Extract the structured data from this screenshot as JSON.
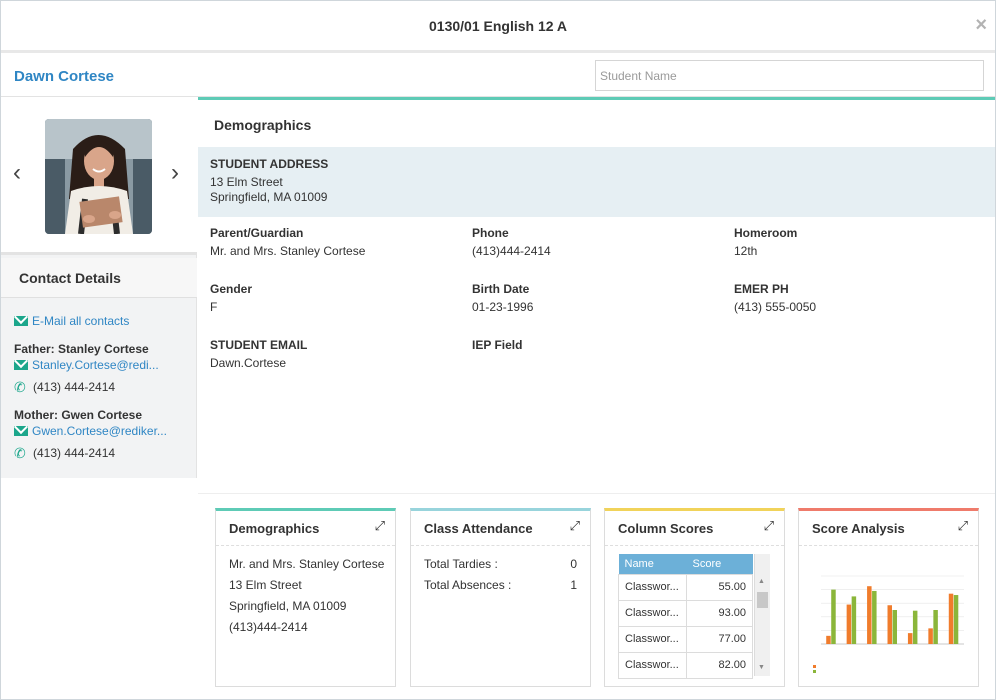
{
  "window": {
    "title": "0130/01 English 12 A",
    "close_glyph": "×"
  },
  "header": {
    "student_name": "Dawn Cortese",
    "search_placeholder": "Student Name"
  },
  "sidebar": {
    "prev_glyph": "‹",
    "next_glyph": "›",
    "contact_details_title": "Contact Details",
    "email_all": "E-Mail all contacts",
    "contacts": [
      {
        "heading": "Father: Stanley Cortese",
        "email": "Stanley.Cortese@redi...",
        "phone": "(413) 444-2414"
      },
      {
        "heading": "Mother: Gwen Cortese",
        "email": "Gwen.Cortese@rediker...",
        "phone": "(413) 444-2414"
      }
    ]
  },
  "demographics": {
    "title": "Demographics",
    "address_label": "STUDENT ADDRESS",
    "address_line1": "13 Elm Street",
    "address_line2": "Springfield, MA 01009",
    "fields": [
      {
        "label": "Parent/Guardian",
        "value": "Mr. and Mrs. Stanley Cortese"
      },
      {
        "label": "Phone",
        "value": "(413)444-2414"
      },
      {
        "label": "Homeroom",
        "value": "12th"
      },
      {
        "label": "Gender",
        "value": "F"
      },
      {
        "label": "Birth Date",
        "value": "01-23-1996"
      },
      {
        "label": "EMER PH",
        "value": "(413) 555-0050"
      },
      {
        "label": "STUDENT EMAIL",
        "value": "Dawn.Cortese"
      },
      {
        "label": "IEP Field",
        "value": ""
      }
    ]
  },
  "cards": {
    "demographics": {
      "title": "Demographics",
      "lines": [
        "Mr. and Mrs. Stanley Cortese",
        "13 Elm Street",
        "Springfield, MA 01009",
        "(413)444-2414"
      ]
    },
    "attendance": {
      "title": "Class Attendance",
      "rows": [
        {
          "label": "Total Tardies :",
          "value": "0"
        },
        {
          "label": "Total Absences :",
          "value": "1"
        }
      ]
    },
    "column_scores": {
      "title": "Column Scores",
      "headers": [
        "Name",
        "Score"
      ],
      "rows": [
        {
          "name": "Classwor...",
          "score": "55.00"
        },
        {
          "name": "Classwor...",
          "score": "93.00"
        },
        {
          "name": "Classwor...",
          "score": "77.00"
        },
        {
          "name": "Classwor...",
          "score": "82.00"
        }
      ]
    },
    "score_analysis": {
      "title": "Score Analysis"
    }
  },
  "colors": {
    "accent_link": "#2f86c4",
    "teal": "#5ecbb6",
    "attendance_top": "#98d4dc",
    "scores_top": "#f1d35a",
    "analysis_top": "#ef7b6b",
    "table_header": "#6cb0d8",
    "bar_orange": "#f07c2c",
    "bar_green": "#8bb63a"
  },
  "chart_data": {
    "type": "bar",
    "title": "",
    "series": [
      {
        "values": [
          12,
          58,
          85,
          57,
          16,
          23,
          74
        ]
      },
      {
        "values": [
          80,
          70,
          78,
          50,
          49,
          50,
          72
        ]
      }
    ],
    "ylim": [
      0,
      100
    ]
  }
}
